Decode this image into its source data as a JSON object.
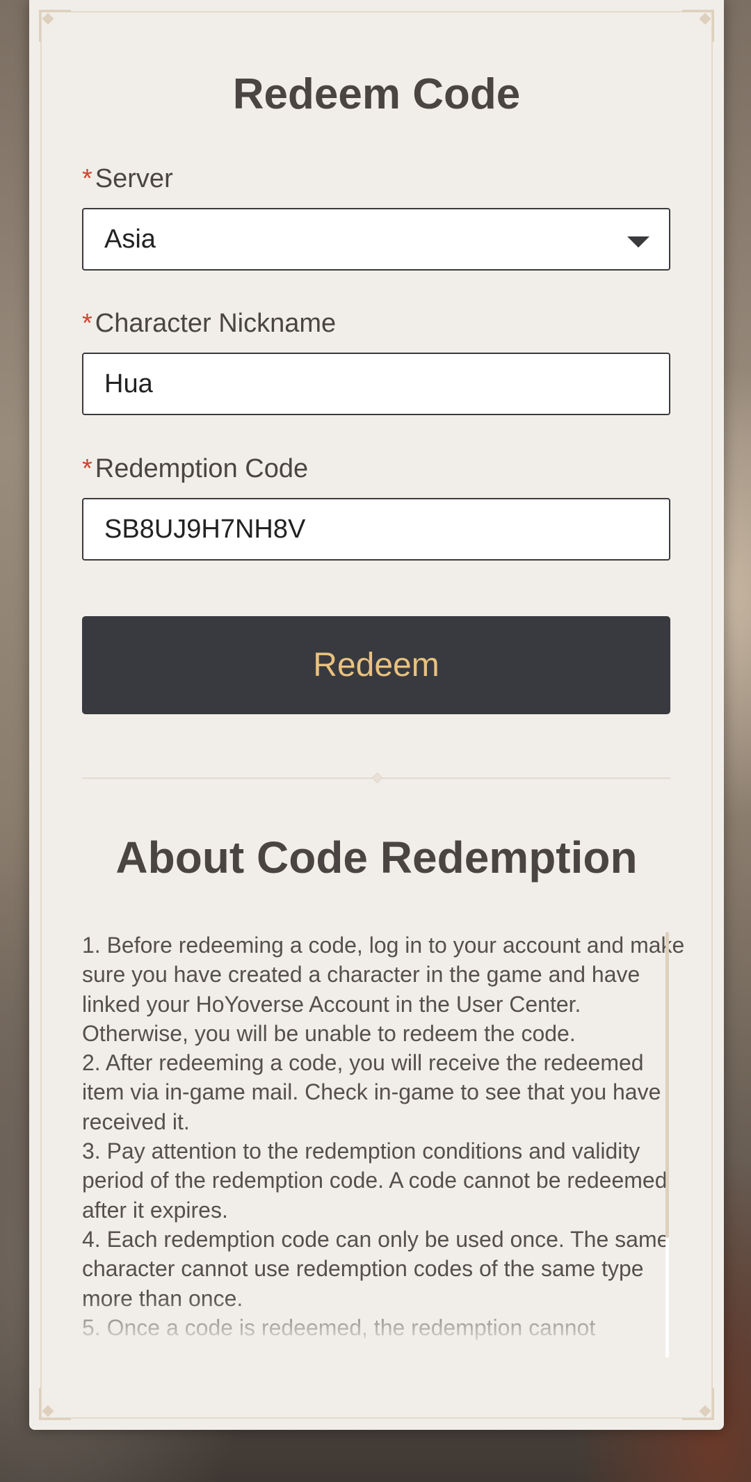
{
  "form": {
    "title": "Redeem Code",
    "required_mark": "*",
    "server": {
      "label": "Server",
      "value": "Asia"
    },
    "nickname": {
      "label": "Character Nickname",
      "value": "Hua"
    },
    "code": {
      "label": "Redemption Code",
      "value": "SB8UJ9H7NH8V"
    },
    "submit_label": "Redeem"
  },
  "about": {
    "title": "About Code Redemption",
    "items": [
      "1. Before redeeming a code, log in to your account and make sure you have created a character in the game and have linked your HoYoverse Account in the User Center. Otherwise, you will be unable to redeem the code.",
      "2. After redeeming a code, you will receive the redeemed item via in-game mail. Check in-game to see that you have received it.",
      "3. Pay attention to the redemption conditions and validity period of the redemption code. A code cannot be redeemed after it expires.",
      "4. Each redemption code can only be used once. The same character cannot use redemption codes of the same type more than once.",
      "5. Once a code is redeemed, the redemption cannot"
    ]
  },
  "colors": {
    "accent_button_bg": "#393a3f",
    "accent_button_text": "#e9c27e",
    "required_mark": "#d0442e",
    "card_bg": "#f1eee9"
  }
}
